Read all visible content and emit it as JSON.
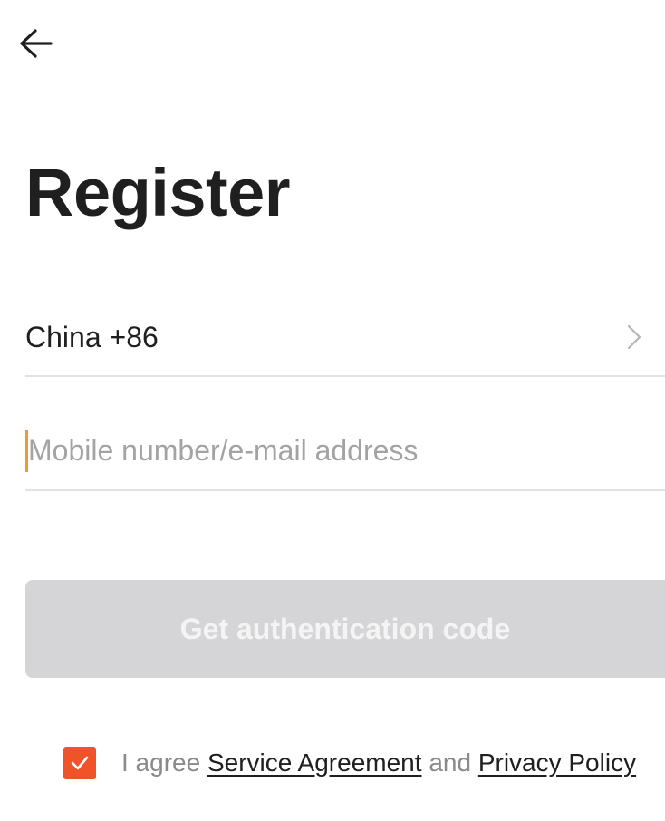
{
  "header": {
    "back_icon": "arrow-left-icon",
    "title": "Register"
  },
  "form": {
    "country": {
      "label": "China +86",
      "chevron_icon": "chevron-right-icon"
    },
    "account_input": {
      "value": "",
      "placeholder": "Mobile number/e-mail address"
    },
    "submit": {
      "label": "Get authentication code",
      "enabled": false
    }
  },
  "agreement": {
    "checked": true,
    "check_icon": "checkmark-icon",
    "prefix": "I agree",
    "service_link": "Service Agreement",
    "conjunction": "and",
    "privacy_link": "Privacy Policy"
  },
  "colors": {
    "accent": "#f0522a",
    "cursor": "#f09a30",
    "disabled_button": "#d5d5d8",
    "placeholder": "#a3a3a3",
    "divider": "#e3e3e3"
  }
}
